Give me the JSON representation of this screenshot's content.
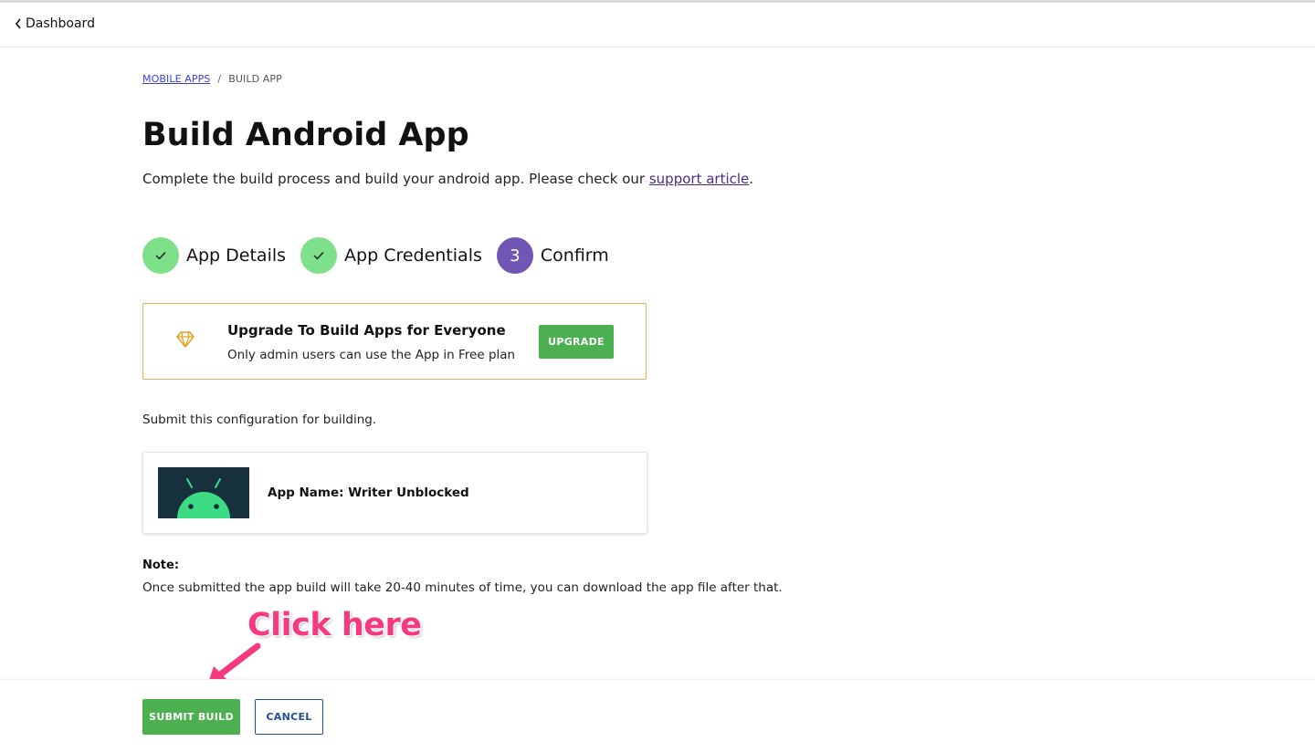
{
  "topbar": {
    "back_label": "Dashboard"
  },
  "breadcrumb": {
    "parent": "MOBILE APPS",
    "separator": "/",
    "current": "BUILD APP"
  },
  "page": {
    "title": "Build Android App",
    "subtitle_text": "Complete the build process and build your android app. Please check our ",
    "subtitle_link": "support article",
    "subtitle_end": "."
  },
  "steps": [
    {
      "label": "App Details",
      "status": "done"
    },
    {
      "label": "App Credentials",
      "status": "done"
    },
    {
      "label": "Confirm",
      "status": "current",
      "number": "3"
    }
  ],
  "upgrade": {
    "title": "Upgrade To Build Apps for Everyone",
    "description": "Only admin users can use the App in Free plan",
    "button_label": "UPGRADE",
    "icon": "diamond-icon"
  },
  "submit_text": "Submit this configuration for building.",
  "app_card": {
    "name": "App Name: Writer Unblocked",
    "thumbnail_icon": "android-icon"
  },
  "note": {
    "label": "Note:",
    "text": "Once submitted the app build will take 20-40 minutes of time, you can download the app file after that."
  },
  "annotation": {
    "text": "Click here"
  },
  "footer": {
    "submit_label": "SUBMIT BUILD",
    "cancel_label": "CANCEL"
  },
  "colors": {
    "step_done": "#7ee08a",
    "step_current": "#7056b5",
    "primary_green": "#4caf50",
    "cancel_blue": "#1f4e9c",
    "annotation_pink": "#f53b7d",
    "upgrade_border": "#d8b45a"
  }
}
